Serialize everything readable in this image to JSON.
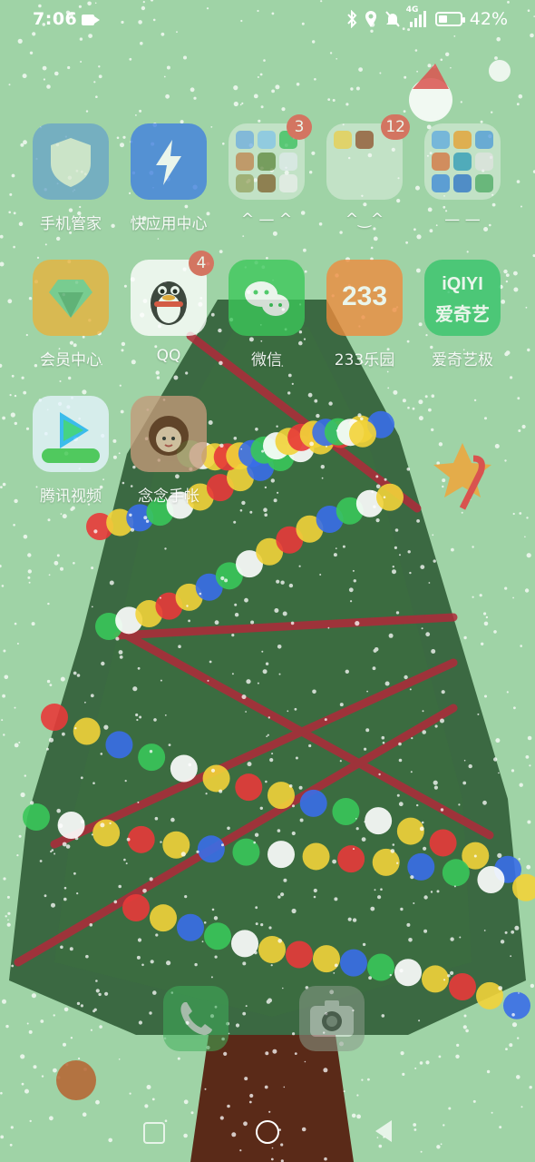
{
  "status_bar": {
    "time": "7:06",
    "network": "4G",
    "battery_percent": "42%",
    "battery_level": 0.42,
    "icons": [
      "video-record-icon",
      "bluetooth-icon",
      "location-icon",
      "mute-icon",
      "signal-icon",
      "battery-icon"
    ]
  },
  "apps": [
    {
      "label": "手机管家",
      "icon": "shield-icon",
      "color": "#6aa6c8"
    },
    {
      "label": "快应用中心",
      "icon": "lightning-icon",
      "color": "#3f7fe0"
    },
    {
      "label": "^ — ^",
      "icon": "folder-icon",
      "badge": "3"
    },
    {
      "label": "^‿^",
      "icon": "folder-icon",
      "badge": "12"
    },
    {
      "label": "—  —",
      "icon": "folder-icon"
    },
    {
      "label": "会员中心",
      "icon": "diamond-icon",
      "color": "#e9b23b"
    },
    {
      "label": "QQ",
      "icon": "penguin-icon",
      "color": "#ffffff",
      "badge": "4"
    },
    {
      "label": "微信",
      "icon": "chat-bubbles-icon",
      "color": "#3cc85a"
    },
    {
      "label": "233乐园",
      "icon": "233-icon",
      "color": "#f08b3c"
    },
    {
      "label": "爱奇艺极",
      "icon": "iqiyi-icon",
      "color": "#35c46b"
    },
    {
      "label": "腾讯视频",
      "icon": "play-icon",
      "color": "#e6f5ff"
    },
    {
      "label": "念念手帐",
      "icon": "girl-avatar-icon",
      "color": "#c49a7a"
    }
  ],
  "logos": {
    "app_233": "233",
    "iqiyi_top": "iQIYI",
    "iqiyi_bottom": "爱奇艺"
  },
  "dock": [
    {
      "icon": "phone-icon"
    },
    {
      "icon": "camera-icon"
    }
  ],
  "nav": [
    "recent-apps-icon",
    "home-icon",
    "back-icon"
  ],
  "colors": {
    "background": "#9fd3a6",
    "badge": "#e25b4e",
    "tree": "#2e5a34",
    "trunk": "#5a2a18"
  }
}
